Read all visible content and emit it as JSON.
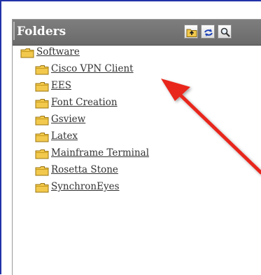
{
  "panel": {
    "title": "Folders",
    "toolbar": [
      {
        "name": "up-folder-button",
        "icon": "up-folder-icon"
      },
      {
        "name": "refresh-button",
        "icon": "refresh-icon"
      },
      {
        "name": "search-button",
        "icon": "search-icon"
      }
    ]
  },
  "tree": {
    "root": {
      "label": "Software",
      "icon": "folder-icon"
    },
    "children": [
      {
        "label": "Cisco VPN Client",
        "icon": "folder-icon"
      },
      {
        "label": "EES",
        "icon": "folder-icon"
      },
      {
        "label": "Font Creation",
        "icon": "folder-icon"
      },
      {
        "label": "Gsview",
        "icon": "folder-icon"
      },
      {
        "label": "Latex",
        "icon": "folder-icon"
      },
      {
        "label": "Mainframe Terminal",
        "icon": "folder-icon"
      },
      {
        "label": "Rosetta Stone",
        "icon": "folder-icon"
      },
      {
        "label": "SynchronEyes",
        "icon": "folder-icon"
      }
    ]
  },
  "colors": {
    "header_bg": "#6f6f6f",
    "frame_border": "#2233a8",
    "annotation_arrow": "#e8261c",
    "folder_fill": "#f2c94c"
  }
}
